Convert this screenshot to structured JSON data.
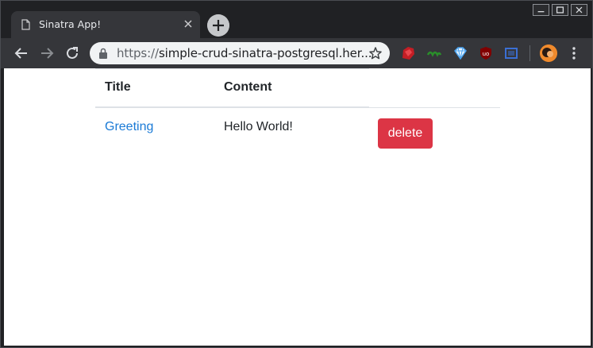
{
  "browser": {
    "tab_title": "Sinatra App!",
    "url_scheme": "https://",
    "url_rest": "simple-crud-sinatra-postgresql.her...",
    "extensions": [
      "ruby-icon",
      "green-extension-icon",
      "diamond-extension-icon",
      "ublock-icon",
      "screen-extension-icon"
    ],
    "colors": {
      "frame": "#202124",
      "toolbar": "#35363a",
      "omnibox": "#f1f3f4"
    }
  },
  "table": {
    "headers": {
      "title": "Title",
      "content": "Content"
    },
    "rows": [
      {
        "title": "Greeting",
        "content": "Hello World!",
        "action": "delete"
      }
    ],
    "colors": {
      "link": "#1a7ad6",
      "danger": "#dc3545"
    }
  }
}
